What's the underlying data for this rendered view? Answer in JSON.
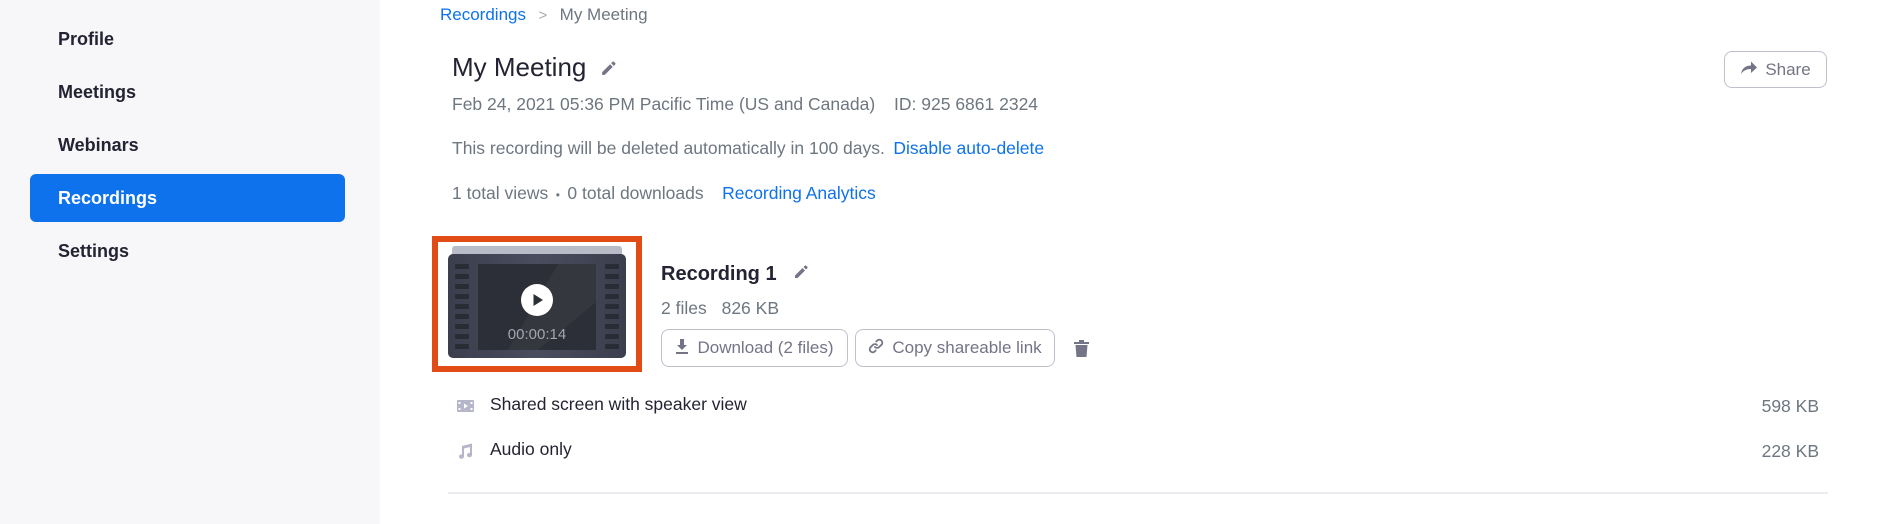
{
  "sidebar": {
    "items": [
      {
        "label": "Profile",
        "active": false
      },
      {
        "label": "Meetings",
        "active": false
      },
      {
        "label": "Webinars",
        "active": false
      },
      {
        "label": "Recordings",
        "active": true
      },
      {
        "label": "Settings",
        "active": false
      }
    ]
  },
  "breadcrumb": {
    "parent": "Recordings",
    "separator": ">",
    "current": "My Meeting"
  },
  "meeting": {
    "title": "My Meeting",
    "datetime": "Feb 24, 2021 05:36 PM Pacific Time (US and Canada)",
    "id_label": "ID: 925 6861 2324",
    "auto_delete_notice": "This recording will be deleted automatically in 100 days.",
    "disable_auto_delete_label": "Disable auto-delete",
    "views": "1 total views",
    "stats_separator": "•",
    "downloads": "0 total downloads",
    "analytics_label": "Recording Analytics",
    "share_label": "Share"
  },
  "recording": {
    "title": "Recording 1",
    "duration": "00:00:14",
    "file_count": "2 files",
    "total_size": "826 KB",
    "download_label": "Download (2 files)",
    "copy_link_label": "Copy shareable link",
    "files": [
      {
        "icon": "video-file-icon",
        "name": "Shared screen with speaker view",
        "size": "598 KB"
      },
      {
        "icon": "audio-file-icon",
        "name": "Audio only",
        "size": "228 KB"
      }
    ]
  },
  "colors": {
    "accent": "#0e72ed",
    "highlight_border": "#e04b16",
    "sidebar_bg": "#f7f7fa",
    "text_primary": "#232333",
    "text_secondary": "#6e7680"
  }
}
